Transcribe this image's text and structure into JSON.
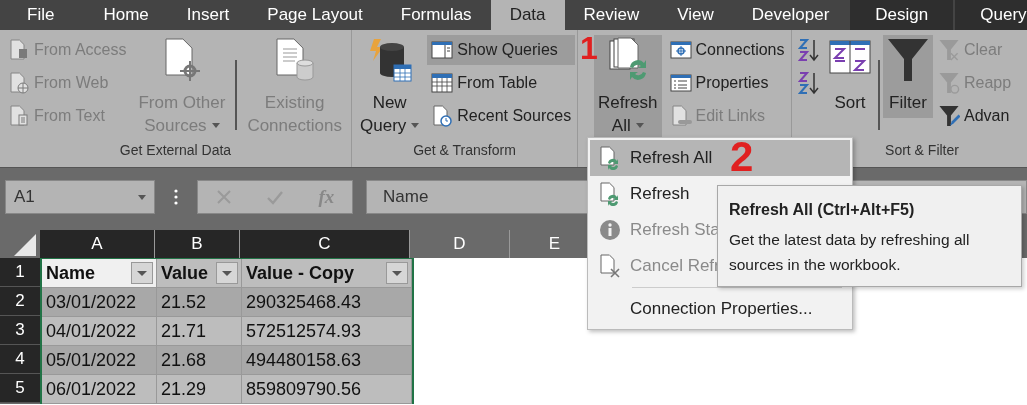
{
  "tabs": [
    {
      "label": "File",
      "selected": false,
      "contextual": false
    },
    {
      "label": "Home",
      "selected": false,
      "contextual": false
    },
    {
      "label": "Insert",
      "selected": false,
      "contextual": false
    },
    {
      "label": "Page Layout",
      "selected": false,
      "contextual": false
    },
    {
      "label": "Formulas",
      "selected": false,
      "contextual": false
    },
    {
      "label": "Data",
      "selected": true,
      "contextual": false
    },
    {
      "label": "Review",
      "selected": false,
      "contextual": false
    },
    {
      "label": "View",
      "selected": false,
      "contextual": false
    },
    {
      "label": "Developer",
      "selected": false,
      "contextual": false
    },
    {
      "label": "Design",
      "selected": false,
      "contextual": true
    },
    {
      "label": "Query",
      "selected": false,
      "contextual": true
    }
  ],
  "ribbon": {
    "groups": [
      {
        "label": "Get External Data",
        "items": [
          {
            "kind": "stack",
            "buttons": [
              {
                "label": "From Access",
                "disabled": true,
                "pressed": false
              },
              {
                "label": "From Web",
                "disabled": true,
                "pressed": false
              },
              {
                "label": "From Text",
                "disabled": true,
                "pressed": false
              }
            ]
          },
          {
            "kind": "large",
            "lines": [
              "From Other",
              "Sources"
            ],
            "dropdown": true,
            "disabled": true,
            "pressed": false
          },
          {
            "kind": "divider"
          },
          {
            "kind": "large",
            "lines": [
              "Existing",
              "Connections"
            ],
            "dropdown": false,
            "disabled": true,
            "pressed": false
          }
        ]
      },
      {
        "label": "Get & Transform",
        "items": [
          {
            "kind": "large",
            "lines": [
              "New",
              "Query"
            ],
            "dropdown": true,
            "disabled": false,
            "pressed": false
          },
          {
            "kind": "stack",
            "buttons": [
              {
                "label": "Show Queries",
                "disabled": false,
                "pressed": true
              },
              {
                "label": "From Table",
                "disabled": false,
                "pressed": false
              },
              {
                "label": "Recent Sources",
                "disabled": false,
                "pressed": false
              }
            ]
          }
        ]
      },
      {
        "items": [
          {
            "kind": "large",
            "lines": [
              "Refresh",
              "All"
            ],
            "dropdown": true,
            "disabled": false,
            "pressed": true
          },
          {
            "kind": "stack",
            "buttons": [
              {
                "label": "Connections",
                "disabled": false,
                "pressed": false
              },
              {
                "label": "Properties",
                "disabled": false,
                "pressed": false
              },
              {
                "label": "Edit Links",
                "disabled": true,
                "pressed": false
              }
            ]
          }
        ]
      },
      {
        "label": "Sort & Filter",
        "items": [
          {
            "kind": "stack",
            "buttons": [
              {
                "disabled": false,
                "pressed": false
              },
              {
                "disabled": false,
                "pressed": false
              }
            ]
          },
          {
            "kind": "large",
            "lines": [
              "Sort"
            ],
            "dropdown": false,
            "disabled": false,
            "pressed": false
          },
          {
            "kind": "divider"
          },
          {
            "kind": "large",
            "lines": [
              "Filter"
            ],
            "dropdown": false,
            "disabled": false,
            "pressed": true
          },
          {
            "kind": "stack",
            "buttons": [
              {
                "label": "Clear",
                "disabled": true,
                "pressed": false
              },
              {
                "label": "Reapp",
                "disabled": true,
                "pressed": false
              },
              {
                "label": "Advan",
                "disabled": false,
                "pressed": false
              }
            ]
          }
        ]
      }
    ]
  },
  "formula_bar": {
    "name_box": "A1",
    "function_label": "fx",
    "formula": "Name"
  },
  "sheet": {
    "columns": [
      {
        "label": "A",
        "selected": true
      },
      {
        "label": "B",
        "selected": true
      },
      {
        "label": "C",
        "selected": true
      },
      {
        "label": "D",
        "selected": false
      },
      {
        "label": "E",
        "selected": false
      }
    ],
    "row_numbers": [
      {
        "label": "1",
        "selected": true
      },
      {
        "label": "2",
        "selected": true
      },
      {
        "label": "3",
        "selected": true
      },
      {
        "label": "4",
        "selected": true
      },
      {
        "label": "5",
        "selected": true
      }
    ],
    "table_header": [
      "Name",
      "Value",
      "Value - Copy"
    ],
    "table_rows": [
      [
        "03/01/2022",
        "21.52",
        "290325468.43"
      ],
      [
        "04/01/2022",
        "21.71",
        "572512574.93"
      ],
      [
        "05/01/2022",
        "21.68",
        "494480158.63"
      ],
      [
        "06/01/2022",
        "21.29",
        "859809790.56"
      ]
    ]
  },
  "menu": {
    "items": [
      {
        "kind": "item",
        "label": "Refresh All",
        "selected": true,
        "disabled": false
      },
      {
        "kind": "item",
        "label": "Refresh",
        "selected": false,
        "disabled": false
      },
      {
        "kind": "item",
        "label": "Refresh Sta",
        "selected": false,
        "disabled": true
      },
      {
        "kind": "item",
        "label": "Cancel Refr",
        "selected": false,
        "disabled": true
      },
      {
        "kind": "separator"
      },
      {
        "kind": "item",
        "label": "Connection Properties...",
        "selected": false,
        "disabled": false
      }
    ]
  },
  "tooltip": {
    "title": "Refresh All (Ctrl+Alt+F5)",
    "text": "Get the latest data by refreshing all sources in the workbook."
  },
  "annotations": [
    {
      "text": "1"
    },
    {
      "text": "2"
    }
  ]
}
